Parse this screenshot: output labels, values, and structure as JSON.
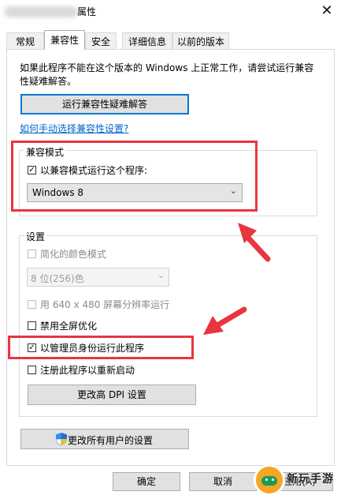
{
  "window": {
    "title": "属性",
    "close_glyph": "✕"
  },
  "tabs": [
    {
      "label": "常规",
      "active": false
    },
    {
      "label": "兼容性",
      "active": true
    },
    {
      "label": "安全",
      "active": false
    },
    {
      "label": "详细信息",
      "active": false
    },
    {
      "label": "以前的版本",
      "active": false
    }
  ],
  "intro_text": "如果此程序不能在这个版本的 Windows 上正常工作，请尝试运行兼容性疑难解答。",
  "troubleshooter_button": "运行兼容性疑难解答",
  "manual_link": "如何手动选择兼容性设置?",
  "compat_mode": {
    "group_label": "兼容模式",
    "checkbox_label": "以兼容模式运行这个程序:",
    "checked": true,
    "selected_os": "Windows 8"
  },
  "settings": {
    "group_label": "设置",
    "reduced_color": {
      "label": "简化的颜色模式",
      "checked": false,
      "enabled": false
    },
    "color_select": "8 位(256)色",
    "res_640": {
      "label": "用 640 x 480 屏幕分辨率运行",
      "checked": false,
      "enabled": false
    },
    "disable_fullscreen": {
      "label": "禁用全屏优化",
      "checked": false
    },
    "run_as_admin": {
      "label": "以管理员身份运行此程序",
      "checked": true
    },
    "register_restart": {
      "label": "注册此程序以重新启动",
      "checked": false
    },
    "dpi_button": "更改高 DPI 设置"
  },
  "all_users_button": "更改所有用户的设置",
  "footer": {
    "ok": "确定",
    "cancel": "取消",
    "apply": "应用(A)"
  },
  "watermark": {
    "text": "新玩手游"
  },
  "annotation_color": "#e8353f",
  "accent_color": "#0078d7"
}
